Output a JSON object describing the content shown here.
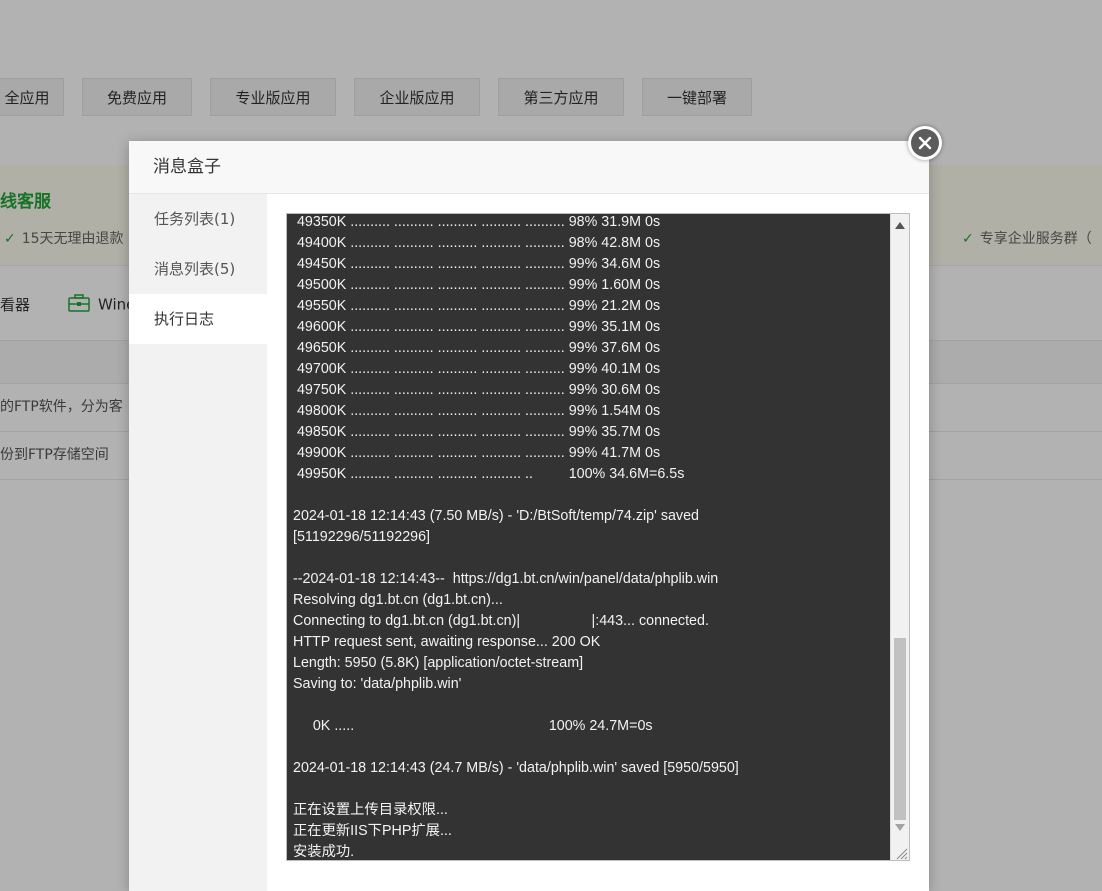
{
  "background": {
    "app_tabs": [
      "全应用",
      "免费应用",
      "专业版应用",
      "企业版应用",
      "第三方应用",
      "一键部署"
    ],
    "banner_title": "线客服",
    "banner_checks": [
      "15天无理由退款",
      "专享企业服务群（"
    ],
    "tools": [
      "看器",
      "Wine"
    ],
    "rows": [
      "的FTP软件，分为客",
      "份到FTP存储空间"
    ]
  },
  "modal": {
    "title": "消息盒子",
    "sidebar": [
      "任务列表(1)",
      "消息列表(5)",
      "执行日志"
    ],
    "log_lines": [
      " 49350K .......... .......... .......... .......... .......... 98% 31.9M 0s",
      " 49400K .......... .......... .......... .......... .......... 98% 42.8M 0s",
      " 49450K .......... .......... .......... .......... .......... 99% 34.6M 0s",
      " 49500K .......... .......... .......... .......... .......... 99% 1.60M 0s",
      " 49550K .......... .......... .......... .......... .......... 99% 21.2M 0s",
      " 49600K .......... .......... .......... .......... .......... 99% 35.1M 0s",
      " 49650K .......... .......... .......... .......... .......... 99% 37.6M 0s",
      " 49700K .......... .......... .......... .......... .......... 99% 40.1M 0s",
      " 49750K .......... .......... .......... .......... .......... 99% 30.6M 0s",
      " 49800K .......... .......... .......... .......... .......... 99% 1.54M 0s",
      " 49850K .......... .......... .......... .......... .......... 99% 35.7M 0s",
      " 49900K .......... .......... .......... .......... .......... 99% 41.7M 0s",
      " 49950K .......... .......... .......... .......... ..         100% 34.6M=6.5s",
      "",
      "2024-01-18 12:14:43 (7.50 MB/s) - 'D:/BtSoft/temp/74.zip' saved",
      "[51192296/51192296]",
      "",
      "--2024-01-18 12:14:43--  https://dg1.bt.cn/win/panel/data/phplib.win",
      "Resolving dg1.bt.cn (dg1.bt.cn)...",
      "Connecting to dg1.bt.cn (dg1.bt.cn)|                  |:443... connected.",
      "HTTP request sent, awaiting response... 200 OK",
      "Length: 5950 (5.8K) [application/octet-stream]",
      "Saving to: 'data/phplib.win'",
      "",
      "     0K .....                                                 100% 24.7M=0s",
      "",
      "2024-01-18 12:14:43 (24.7 MB/s) - 'data/phplib.win' saved [5950/5950]",
      "",
      "正在设置上传目录权限...",
      "正在更新IIS下PHP扩展...",
      "安装成功."
    ]
  }
}
